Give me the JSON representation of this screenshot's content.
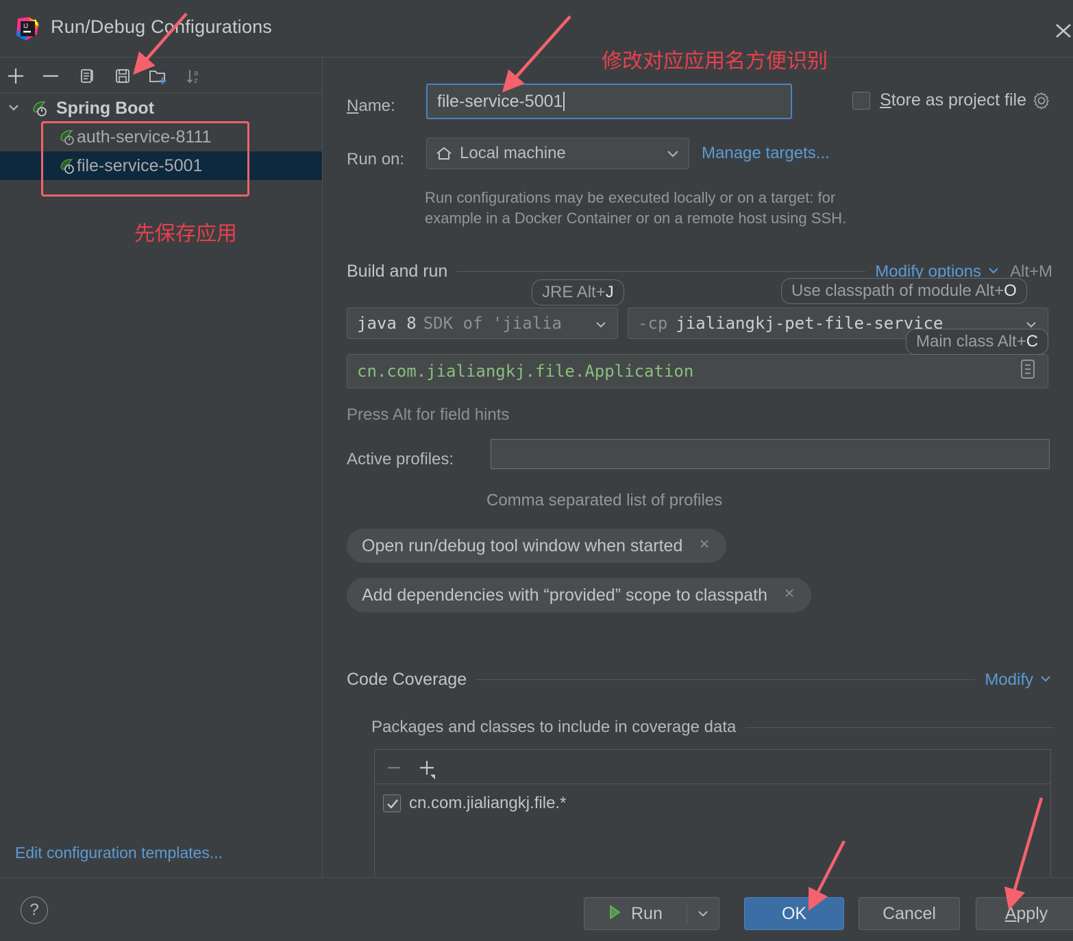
{
  "window": {
    "title": "Run/Debug Configurations",
    "logo_icon": "intellij-idea-logo",
    "close_icon": "close-icon"
  },
  "sidebar": {
    "toolbar": [
      {
        "name": "add-configuration-button",
        "icon": "plus-icon"
      },
      {
        "name": "remove-configuration-button",
        "icon": "minus-icon"
      },
      {
        "name": "copy-configuration-button",
        "icon": "copy-icon"
      },
      {
        "name": "save-configuration-button",
        "icon": "floppy-save-icon"
      },
      {
        "name": "new-folder-button",
        "icon": "folder-plus-icon"
      },
      {
        "name": "sort-alphabetically-button",
        "icon": "sort-az-icon"
      }
    ],
    "tree": [
      {
        "label": "Spring Boot",
        "type": "group",
        "expanded": true,
        "icon": "spring-boot-icon"
      },
      {
        "label": "auth-service-8111",
        "type": "item",
        "selected": false,
        "icon": "spring-boot-icon"
      },
      {
        "label": "file-service-5001",
        "type": "item",
        "selected": true,
        "icon": "spring-boot-icon"
      }
    ],
    "edit_templates_link": "Edit configuration templates..."
  },
  "form": {
    "name_label": "Name:",
    "name_label_mnemonic": "N",
    "name_value": "file-service-5001",
    "store_as_project_file": {
      "label": "Store as project file",
      "mnemonic": "S",
      "checked": false,
      "gear_icon": "gear-icon"
    },
    "run_on_label": "Run on:",
    "run_on_value": "Local machine",
    "run_on_icon": "home-icon",
    "manage_targets_link": "Manage targets...",
    "run_on_hint_line1": "Run configurations may be executed locally or on a target: for",
    "run_on_hint_line2": "example in a Docker Container or on a remote host using SSH."
  },
  "build_and_run": {
    "section_title": "Build and run",
    "modify_options_link": "Modify options",
    "modify_options_shortcut": "Alt+M",
    "jre_hint": "JRE Alt+J",
    "jre_hint_key": "J",
    "module_hint": "Use classpath of module Alt+O",
    "module_hint_key": "O",
    "main_class_hint": "Main class Alt+C",
    "main_class_hint_key": "C",
    "jre_value_bold": "java 8",
    "jre_value_dim": "SDK of 'jialia",
    "cp_flag": "-cp",
    "cp_value": "jialiangkj-pet-file-service",
    "main_class_value": "cn.com.jialiangkj.file.Application",
    "main_class_browse_icon": "list-browse-icon",
    "press_alt_hint": "Press Alt for field hints",
    "active_profiles_label": "Active profiles:",
    "active_profiles_value": "",
    "active_profiles_hint": "Comma separated list of profiles",
    "chips": [
      {
        "label": "Open run/debug tool window when started",
        "close_icon": "close-icon"
      },
      {
        "label": "Add dependencies with “provided” scope to classpath",
        "close_icon": "close-icon"
      }
    ]
  },
  "code_coverage": {
    "section_title": "Code Coverage",
    "modify_link": "Modify",
    "packages_title": "Packages and classes to include in coverage data",
    "toolbar": [
      {
        "name": "remove-package-button",
        "icon": "minus-icon"
      },
      {
        "name": "add-package-button",
        "icon": "plus-dropdown-icon"
      }
    ],
    "rows": [
      {
        "checked": true,
        "text": "cn.com.jialiangkj.file.*"
      }
    ]
  },
  "footer": {
    "help_label": "?",
    "run_label": "Run",
    "run_icon": "play-icon",
    "run_dropdown_icon": "chevron-down-icon",
    "ok_label": "OK",
    "cancel_label": "Cancel",
    "apply_label": "Apply",
    "apply_mnemonic": "A"
  },
  "annotations": {
    "note_top": "修改对应应用名方便识别",
    "note_sidebar": "先保存应用",
    "color": "#e8404c",
    "highlight_color": "#f4626d"
  }
}
